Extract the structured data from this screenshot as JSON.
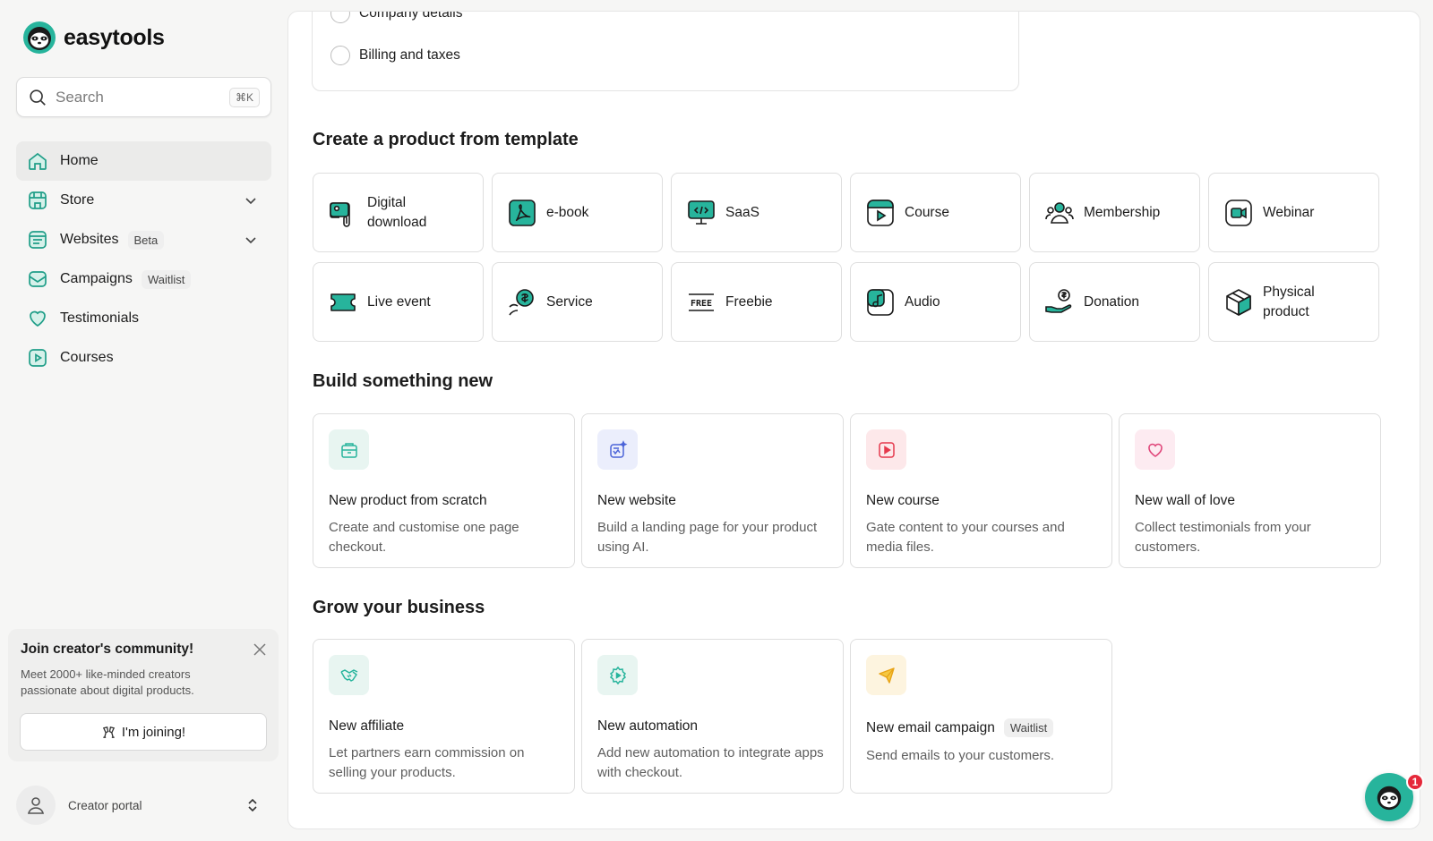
{
  "brand": {
    "name": "easytools"
  },
  "search": {
    "placeholder": "Search",
    "shortcut": "⌘K"
  },
  "nav": [
    {
      "label": "Home",
      "icon": "home-icon",
      "active": true
    },
    {
      "label": "Store",
      "icon": "store-icon",
      "chevron": true
    },
    {
      "label": "Websites",
      "icon": "websites-icon",
      "badge": "Beta",
      "chevron": true
    },
    {
      "label": "Campaigns",
      "icon": "campaigns-icon",
      "badge": "Waitlist"
    },
    {
      "label": "Testimonials",
      "icon": "heart-icon"
    },
    {
      "label": "Courses",
      "icon": "play-icon"
    }
  ],
  "community": {
    "title": "Join creator's community!",
    "text": "Meet 2000+ like-minded creators passionate about digital products.",
    "button": "I'm joining!"
  },
  "portal": {
    "label": "Creator portal"
  },
  "steps": [
    "Company details",
    "Billing and taxes"
  ],
  "sections": {
    "templates": "Create a product from template",
    "build": "Build something new",
    "grow": "Grow your business"
  },
  "templates": [
    {
      "label": "Digital download",
      "icon": "digital-download-icon"
    },
    {
      "label": "e-book",
      "icon": "ebook-icon"
    },
    {
      "label": "SaaS",
      "icon": "saas-icon"
    },
    {
      "label": "Course",
      "icon": "course-icon"
    },
    {
      "label": "Membership",
      "icon": "membership-icon"
    },
    {
      "label": "Webinar",
      "icon": "webinar-icon"
    },
    {
      "label": "Live event",
      "icon": "ticket-icon"
    },
    {
      "label": "Service",
      "icon": "service-icon"
    },
    {
      "label": "Freebie",
      "icon": "free-icon"
    },
    {
      "label": "Audio",
      "icon": "audio-icon"
    },
    {
      "label": "Donation",
      "icon": "donation-icon"
    },
    {
      "label": "Physical product",
      "icon": "box-icon"
    }
  ],
  "build_cards": [
    {
      "title": "New product from scratch",
      "desc": "Create and customise one page checkout.",
      "icon": "product-icon",
      "bg": "#e8f5f1",
      "color": "#27b49c"
    },
    {
      "title": "New website",
      "desc": "Build a landing page for your product using AI.",
      "icon": "website-ai-icon",
      "bg": "#ebeefc",
      "color": "#4b63d8"
    },
    {
      "title": "New course",
      "desc": "Gate content to your courses and media files.",
      "icon": "course-play-icon",
      "bg": "#fde8ea",
      "color": "#e5384c"
    },
    {
      "title": "New wall of love",
      "desc": "Collect testimonials from your customers.",
      "icon": "heart-icon",
      "bg": "#fdebf1",
      "color": "#e0467a"
    }
  ],
  "grow_cards": [
    {
      "title": "New affiliate",
      "desc": "Let partners earn commission on selling your products.",
      "icon": "handshake-icon",
      "bg": "#e8f5f1",
      "color": "#27b49c"
    },
    {
      "title": "New automation",
      "desc": "Add new automation to integrate apps with checkout.",
      "icon": "gear-icon",
      "bg": "#e8f5f1",
      "color": "#27b49c"
    },
    {
      "title": "New email campaign",
      "desc": "Send emails to your customers.",
      "icon": "paper-plane-icon",
      "badge": "Waitlist",
      "bg": "#fdf4df",
      "color": "#e8a317"
    }
  ],
  "chat": {
    "count": "1"
  },
  "colors": {
    "accent": "#27b49c",
    "accent_dark": "#1a1a1a"
  }
}
